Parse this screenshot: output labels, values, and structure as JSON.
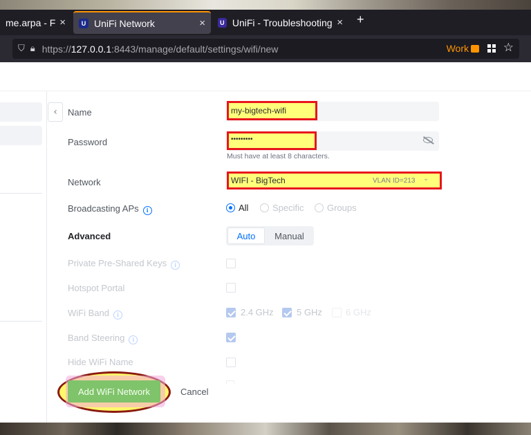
{
  "browser": {
    "tabs": [
      {
        "label": "me.arpa - Fire",
        "close": "×"
      },
      {
        "label": "UniFi Network",
        "close": "×",
        "favicon": "U"
      },
      {
        "label": "UniFi - Troubleshooting U",
        "close": "×",
        "favicon": "U"
      }
    ],
    "new_tab": "+",
    "url_prefix": "https://",
    "url_host": "127.0.0.1",
    "url_rest": ":8443/manage/default/settings/wifi/new",
    "container_label": "Work"
  },
  "form": {
    "name_label": "Name",
    "name_value": "my-bigtech-wifi",
    "password_label": "Password",
    "password_value": "•••••••••",
    "password_hint": "Must have at least 8 characters.",
    "network_label": "Network",
    "network_value": "WIFI - BigTech",
    "network_vlan": "VLAN ID=213",
    "broadcasting_label": "Broadcasting APs",
    "broadcasting_options": [
      "All",
      "Specific",
      "Groups"
    ],
    "advanced_label": "Advanced",
    "advanced_options": [
      "Auto",
      "Manual"
    ],
    "ppsk_label": "Private Pre-Shared Keys",
    "hotspot_label": "Hotspot Portal",
    "wifiband_label": "WiFi Band",
    "band_options": [
      "2.4 GHz",
      "5 GHz",
      "6 GHz"
    ],
    "steering_label": "Band Steering",
    "hidename_label": "Hide WiFi Name",
    "submit_label": "Add WiFi Network",
    "cancel_label": "Cancel"
  },
  "colors": {
    "accent": "#006fff",
    "highlight_fill": "#ffff7a",
    "highlight_border": "#e8151b",
    "firefox_container": "#ff9400",
    "submit_green": "#7fc36a"
  }
}
